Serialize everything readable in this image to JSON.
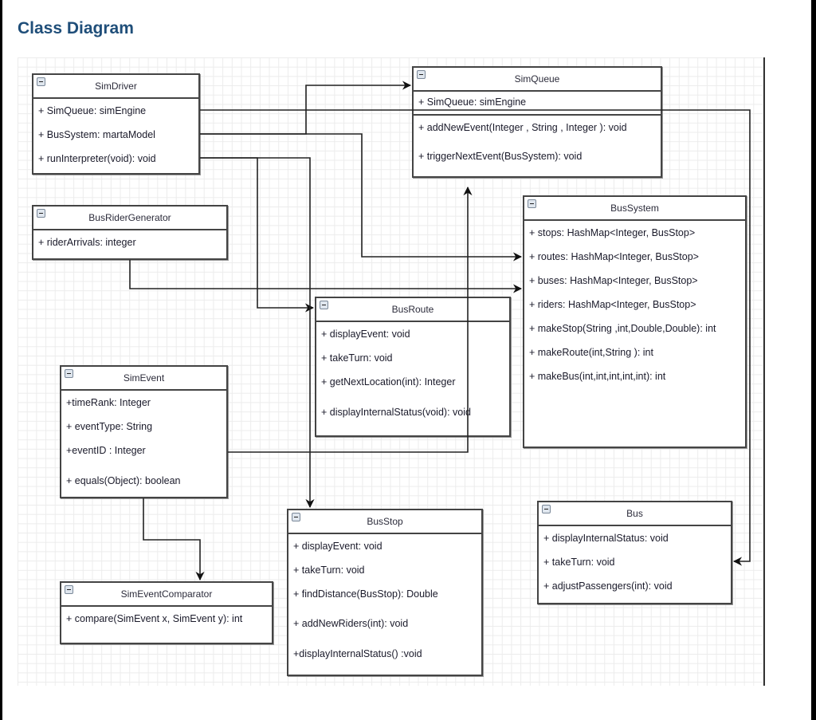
{
  "title": "Class Diagram",
  "colors": {
    "title": "#1f4e79",
    "border": "#444444",
    "grid": "#ececec"
  },
  "classes": {
    "simdriver": {
      "name": "SimDriver",
      "members": [
        "+ SimQueue: simEngine",
        "+ BusSystem: martaModel",
        "+ runInterpreter(void): void"
      ]
    },
    "simqueue": {
      "name": "SimQueue",
      "attributes": [
        "+ SimQueue: simEngine"
      ],
      "methods": [
        "+ addNewEvent(Integer , String , Integer ): void",
        "+ triggerNextEvent(BusSystem): void"
      ]
    },
    "busridergenerator": {
      "name": "BusRiderGenerator",
      "members": [
        "+ riderArrivals: integer"
      ]
    },
    "bussystem": {
      "name": "BusSystem",
      "members": [
        "+ stops: HashMap<Integer, BusStop>",
        "+ routes: HashMap<Integer, BusStop>",
        "+ buses: HashMap<Integer, BusStop>",
        "+ riders: HashMap<Integer, BusStop>",
        "+ makeStop(String ,int,Double,Double): int",
        "+ makeRoute(int,String ): int",
        "+ makeBus(int,int,int,int,int): int"
      ]
    },
    "busroute": {
      "name": "BusRoute",
      "members": [
        "+ displayEvent: void",
        "+ takeTurn: void",
        "+ getNextLocation(int): Integer",
        "+ displayInternalStatus(void): void"
      ]
    },
    "simevent": {
      "name": "SimEvent",
      "members": [
        "+timeRank: Integer",
        "+ eventType: String",
        "+eventID : Integer",
        "+ equals(Object): boolean"
      ]
    },
    "simeventcomparator": {
      "name": "SimEventComparator",
      "members": [
        "+ compare(SimEvent x, SimEvent y): int"
      ]
    },
    "busstop": {
      "name": "BusStop",
      "members": [
        "+ displayEvent: void",
        "+ takeTurn: void",
        "+ findDistance(BusStop): Double",
        "+ addNewRiders(int): void",
        "+displayInternalStatus() :void"
      ]
    },
    "bus": {
      "name": "Bus",
      "members": [
        "+ displayInternalStatus: void",
        "+ takeTurn: void",
        "+ adjustPassengers(int): void"
      ]
    }
  }
}
